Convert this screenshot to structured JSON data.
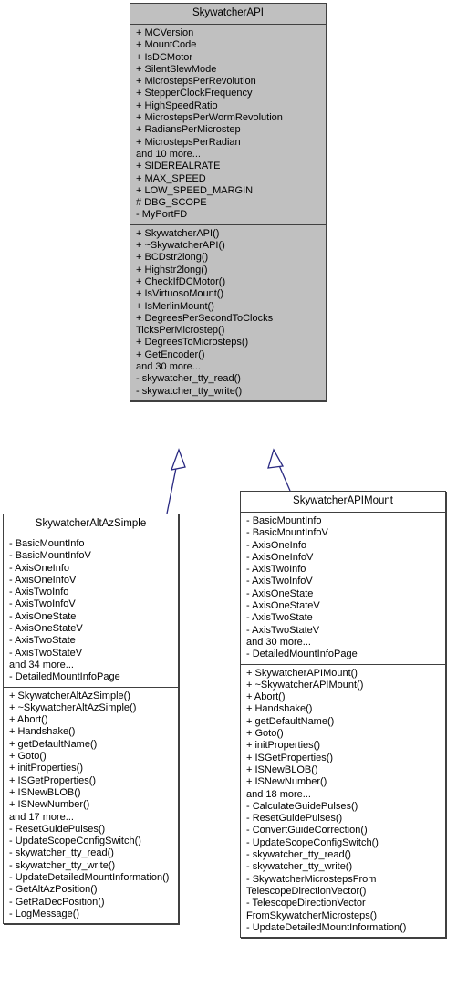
{
  "diagram": {
    "type": "uml-class-inheritance",
    "accent_color": "#2a2a82",
    "base_fill": "#c0c0c0",
    "derived_fill": "#ffffff",
    "border_color": "#404040"
  },
  "classes": {
    "base": {
      "name": "SkywatcherAPI",
      "attributes": [
        "+ MCVersion",
        "+ MountCode",
        "+ IsDCMotor",
        "+ SilentSlewMode",
        "+ MicrostepsPerRevolution",
        "+ StepperClockFrequency",
        "+ HighSpeedRatio",
        "+ MicrostepsPerWormRevolution",
        "+ RadiansPerMicrostep",
        "+ MicrostepsPerRadian",
        "and 10 more...",
        "+ SIDEREALRATE",
        "+ MAX_SPEED",
        "+ LOW_SPEED_MARGIN",
        "# DBG_SCOPE",
        "- MyPortFD"
      ],
      "methods": [
        "+ SkywatcherAPI()",
        "+ ~SkywatcherAPI()",
        "+ BCDstr2long()",
        "+ Highstr2long()",
        "+ CheckIfDCMotor()",
        "+ IsVirtuosoMount()",
        "+ IsMerlinMount()",
        "+ DegreesPerSecondToClocks\nTicksPerMicrostep()",
        "+ DegreesToMicrosteps()",
        "+ GetEncoder()",
        "and 30 more...",
        "- skywatcher_tty_read()",
        "- skywatcher_tty_write()"
      ]
    },
    "derived_left": {
      "name": "SkywatcherAltAzSimple",
      "attributes": [
        "- BasicMountInfo",
        "- BasicMountInfoV",
        "- AxisOneInfo",
        "- AxisOneInfoV",
        "- AxisTwoInfo",
        "- AxisTwoInfoV",
        "- AxisOneState",
        "- AxisOneStateV",
        "- AxisTwoState",
        "- AxisTwoStateV",
        "and 34 more...",
        "- DetailedMountInfoPage"
      ],
      "methods": [
        "+ SkywatcherAltAzSimple()",
        "+ ~SkywatcherAltAzSimple()",
        "+ Abort()",
        "+ Handshake()",
        "+ getDefaultName()",
        "+ Goto()",
        "+ initProperties()",
        "+ ISGetProperties()",
        "+ ISNewBLOB()",
        "+ ISNewNumber()",
        "and 17 more...",
        "- ResetGuidePulses()",
        "- UpdateScopeConfigSwitch()",
        "- skywatcher_tty_read()",
        "- skywatcher_tty_write()",
        "- UpdateDetailedMountInformation()",
        "- GetAltAzPosition()",
        "- GetRaDecPosition()",
        "- LogMessage()"
      ]
    },
    "derived_right": {
      "name": "SkywatcherAPIMount",
      "attributes": [
        "- BasicMountInfo",
        "- BasicMountInfoV",
        "- AxisOneInfo",
        "- AxisOneInfoV",
        "- AxisTwoInfo",
        "- AxisTwoInfoV",
        "- AxisOneState",
        "- AxisOneStateV",
        "- AxisTwoState",
        "- AxisTwoStateV",
        "and 30 more...",
        "- DetailedMountInfoPage"
      ],
      "methods": [
        "+ SkywatcherAPIMount()",
        "+ ~SkywatcherAPIMount()",
        "+ Abort()",
        "+ Handshake()",
        "+ getDefaultName()",
        "+ Goto()",
        "+ initProperties()",
        "+ ISGetProperties()",
        "+ ISNewBLOB()",
        "+ ISNewNumber()",
        "and 18 more...",
        "- CalculateGuidePulses()",
        "- ResetGuidePulses()",
        "- ConvertGuideCorrection()",
        "- UpdateScopeConfigSwitch()",
        "- skywatcher_tty_read()",
        "- skywatcher_tty_write()",
        "- SkywatcherMicrostepsFrom\nTelescopeDirectionVector()",
        "- TelescopeDirectionVector\nFromSkywatcherMicrosteps()",
        "- UpdateDetailedMountInformation()"
      ]
    }
  }
}
